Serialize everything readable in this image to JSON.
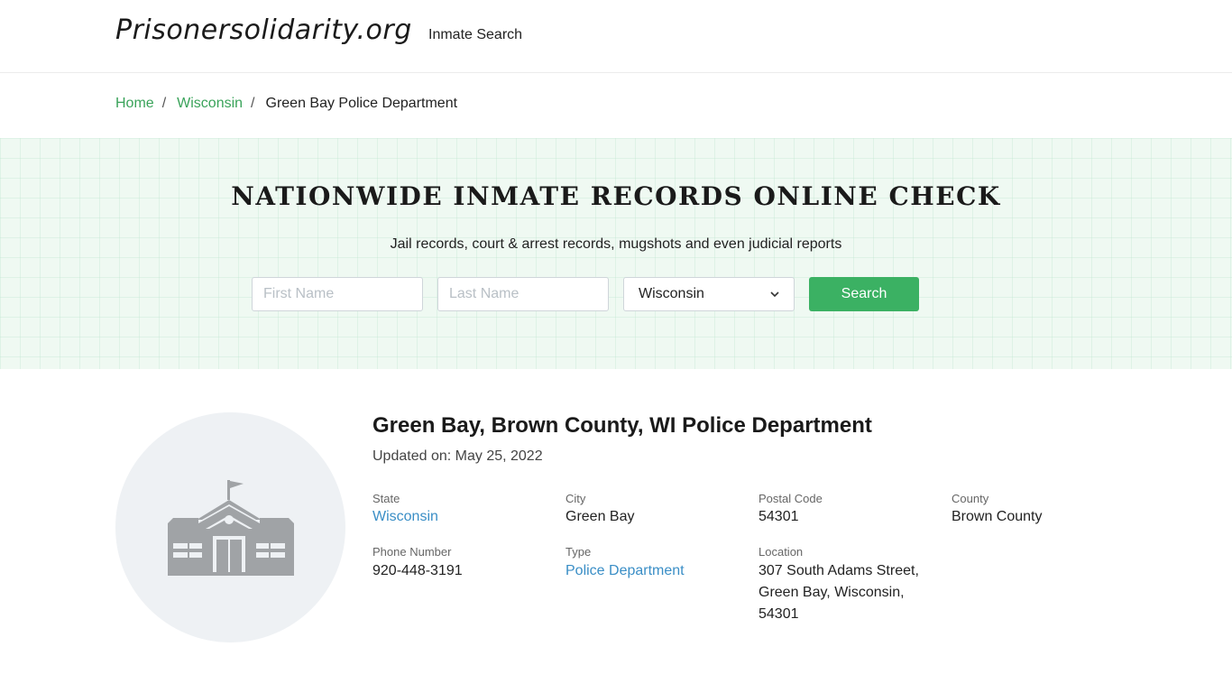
{
  "header": {
    "logo": "Prisonersolidarity.org",
    "nav_inmate_search": "Inmate Search"
  },
  "breadcrumb": {
    "home": "Home",
    "state": "Wisconsin",
    "current": "Green Bay Police Department",
    "separator": "/"
  },
  "hero": {
    "title": "NATIONWIDE INMATE RECORDS ONLINE CHECK",
    "subtitle": "Jail records, court & arrest records, mugshots and even judicial reports",
    "first_name_placeholder": "First Name",
    "last_name_placeholder": "Last Name",
    "state_selected": "Wisconsin",
    "search_label": "Search"
  },
  "detail": {
    "title": "Green Bay, Brown County, WI Police Department",
    "updated_label": "Updated on:",
    "updated_value": "May 25, 2022",
    "state_label": "State",
    "state_value": "Wisconsin",
    "city_label": "City",
    "city_value": "Green Bay",
    "postal_label": "Postal Code",
    "postal_value": "54301",
    "county_label": "County",
    "county_value": "Brown County",
    "phone_label": "Phone Number",
    "phone_value": "920-448-3191",
    "type_label": "Type",
    "type_value": "Police Department",
    "location_label": "Location",
    "location_line1": "307 South Adams Street,",
    "location_line2": "Green Bay, Wisconsin,",
    "location_line3": "54301",
    "icon": "building-icon"
  },
  "colors": {
    "accent_green": "#3bb163",
    "link_blue": "#3a8ec6",
    "breadcrumb_green": "#3aa35a",
    "hero_bg": "#eff9f2"
  }
}
